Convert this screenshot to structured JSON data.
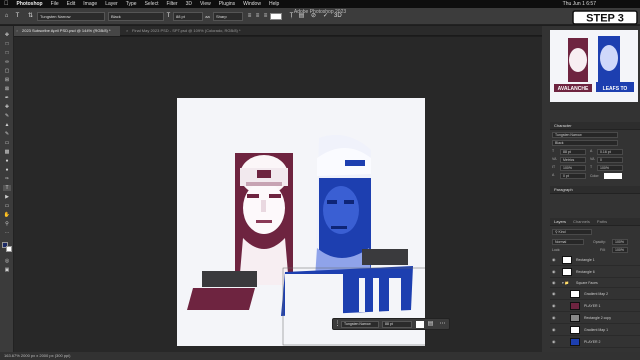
{
  "menubar": {
    "app_name": "Photoshop",
    "items": [
      "File",
      "Edit",
      "Image",
      "Layer",
      "Type",
      "Select",
      "Filter",
      "3D",
      "View",
      "Plugins",
      "Window",
      "Help"
    ],
    "clock": "Thu Jun 1  6:57"
  },
  "window_title": "Adobe Photoshop 2023",
  "options": {
    "font_family": "Tungsten Narrow",
    "font_style": "Black",
    "font_size": "88 pt",
    "anti_alias": "Sharp"
  },
  "tabs": [
    {
      "label": "2023 Subscribe April PSD.psd @ 144% (RGB/8) *",
      "active": true
    },
    {
      "label": "Final May 2023 PSD - SPT.psd @ 109% (Colorado, RGB/8) *",
      "active": false
    }
  ],
  "status": "163.67%    2000 px x 2000 px (300 ppi)",
  "step_badge": "STEP 3",
  "thumbnail": {
    "left_text": "AVALANCHE",
    "right_text": "LEAFS TO"
  },
  "character_panel": {
    "title": "Character",
    "font_family": "Tungsten Narrow",
    "font_style": "Black",
    "size": "88 pt",
    "leading": "0.16 pt",
    "kerning": "Metrics",
    "tracking": "0",
    "vscale": "100%",
    "hscale": "100%",
    "baseline": "0 pt",
    "color_label": "Color:"
  },
  "paragraph_panel": {
    "title": "Paragraph"
  },
  "layers_panel": {
    "tabs": [
      "Layers",
      "Channels",
      "Paths"
    ],
    "blend_mode": "Normal",
    "opacity_label": "Opacity:",
    "opacity": "100%",
    "lock_label": "Lock:",
    "fill_label": "Fill:",
    "fill": "100%",
    "layers": [
      {
        "name": "Rectangle 1",
        "indent": 0
      },
      {
        "name": "Rectangle 6",
        "indent": 0
      },
      {
        "name": "Square Faces",
        "indent": 0,
        "group": true
      },
      {
        "name": "Gradient Map 2",
        "indent": 1
      },
      {
        "name": "PLAYER 1",
        "indent": 1
      },
      {
        "name": "Rectangle 2 copy",
        "indent": 1
      },
      {
        "name": "Gradient Map 1",
        "indent": 1
      },
      {
        "name": "PLAYER 2",
        "indent": 1
      }
    ]
  },
  "floating_bar": {
    "font_family": "Tungsten Narrow",
    "font_size": "88 pt"
  },
  "canvas": {
    "bg_color": "#f4f5f9",
    "maroon": "#6e2440",
    "blue": "#1d3fb0",
    "dark_gray": "#3a3a3d"
  }
}
